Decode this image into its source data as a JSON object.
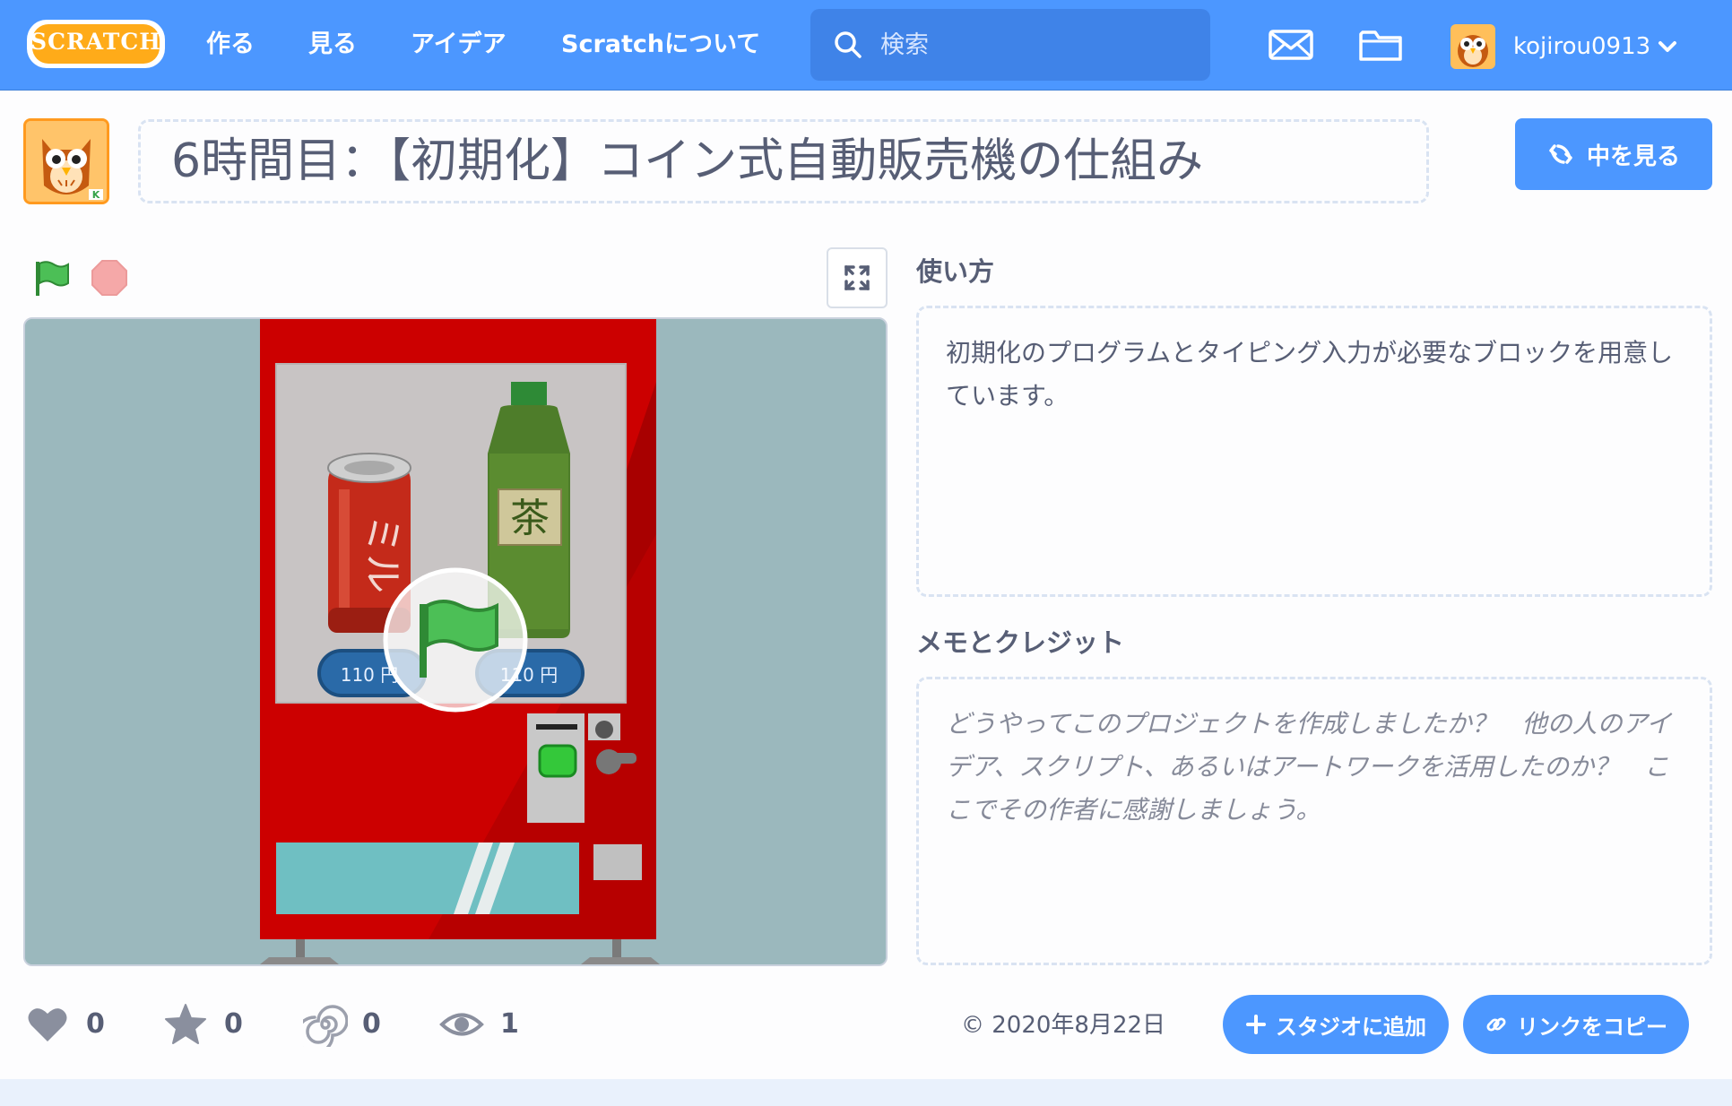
{
  "nav": {
    "logo_text": "SCRATCH",
    "links": [
      "作る",
      "見る",
      "アイデア",
      "Scratchについて"
    ],
    "search_placeholder": "検索",
    "username": "kojirou0913",
    "icons": [
      "search-icon",
      "mail-icon",
      "folder-icon",
      "chevron-down-icon"
    ]
  },
  "project": {
    "title": "6時間目：【初期化】コイン式自動販売機の仕組み",
    "see_inside_label": "中を見る"
  },
  "player": {
    "controls": [
      "green-flag-icon",
      "stop-icon",
      "fullscreen-icon"
    ],
    "stage": {
      "price_left": "110 円",
      "price_right": "110 円",
      "can_label": "ミル",
      "bottle_label": "茶",
      "colors": {
        "machine": "#cc0000",
        "background": "#9bb8bd",
        "display": "#c8c4c4"
      }
    }
  },
  "instructions": {
    "label": "使い方",
    "text": "初期化のプログラムとタイピング入力が必要なブロックを用意しています。"
  },
  "notes": {
    "label": "メモとクレジット",
    "placeholder": "どうやってこのプロジェクトを作成しましたか？　他の人のアイデア、スクリプト、あるいはアートワークを活用したのか？　ここでその作者に感謝しましょう。"
  },
  "stats": {
    "loves": "0",
    "favorites": "0",
    "remixes": "0",
    "views": "1"
  },
  "share_date": "© 2020年8月22日",
  "buttons": {
    "add_to_studio": "スタジオに追加",
    "copy_link": "リンクをコピー"
  },
  "colors": {
    "brand": "#4c97ff",
    "text": "#575e75",
    "accent_orange": "#ff9a1f"
  }
}
